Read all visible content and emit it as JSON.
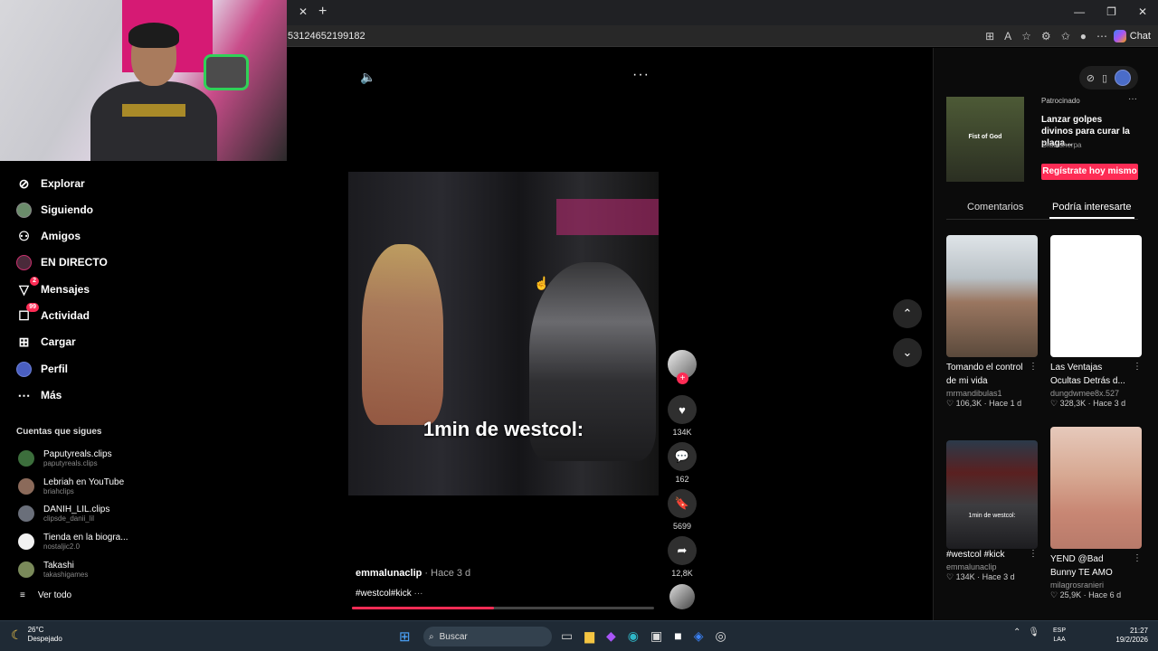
{
  "browser": {
    "tab_close": "✕",
    "new_tab": "+",
    "url": "53124652199182",
    "chat_label": "Chat",
    "window_controls": [
      "—",
      "❐",
      "✕"
    ],
    "toolbar_icons": [
      "grid-icon",
      "translate-icon",
      "star-icon",
      "extensions-icon",
      "favorites-icon",
      "profile-icon",
      "menu-icon"
    ]
  },
  "sidebar": {
    "items": [
      {
        "label": "Explorar",
        "icon": "compass-icon",
        "glyph": "⊘"
      },
      {
        "label": "Siguiendo",
        "icon": "avatar-icon",
        "glyph": ""
      },
      {
        "label": "Amigos",
        "icon": "people-icon",
        "glyph": "⚇"
      },
      {
        "label": "EN DIRECTO",
        "icon": "live-icon",
        "glyph": ""
      },
      {
        "label": "Mensajes",
        "icon": "send-icon",
        "glyph": "▽",
        "badge": "2"
      },
      {
        "label": "Actividad",
        "icon": "activity-icon",
        "glyph": "☐",
        "badge": "99"
      },
      {
        "label": "Cargar",
        "icon": "plus-icon",
        "glyph": "⊞"
      },
      {
        "label": "Perfil",
        "icon": "profile-avatar-icon",
        "glyph": ""
      },
      {
        "label": "Más",
        "icon": "more-icon",
        "glyph": "⋯"
      }
    ],
    "following_title": "Cuentas que sigues",
    "accounts": [
      {
        "name": "Paputyreals.clips",
        "handle": "paputyreals.clips"
      },
      {
        "name": "Lebriah en YouTube",
        "handle": "briahclips"
      },
      {
        "name": "DANIH_LIL.clips",
        "handle": "clipsde_danii_lil"
      },
      {
        "name": "Tienda en la biogra...",
        "handle": "nostaljic2.0"
      },
      {
        "name": "Takashi",
        "handle": "takashigames"
      }
    ],
    "see_all": "Ver todo"
  },
  "video": {
    "caption": "1min de westcol:",
    "author": "emmalunaclip",
    "time": "· Hace 3 d",
    "hashtags": "#westcol#kick",
    "more": "···",
    "progress": 0.47
  },
  "actions": {
    "likes": "134K",
    "comments": "162",
    "saves": "5699",
    "shares": "12,8K"
  },
  "ad": {
    "thumb_text": "Fist of God",
    "label": "Patrocinado",
    "title": "Lanzar golpes divinos para curar la plaga...",
    "sponsor": "Gran sherpa",
    "cta": "Regístrate hoy mismo"
  },
  "right_tabs": {
    "comments": "Comentarios",
    "suggested": "Podría interesarte"
  },
  "cards": [
    {
      "title": "Tomando el control de mi vida",
      "user": "mrmandibulas1",
      "likes": "106,3K",
      "time": "Hace 1 d"
    },
    {
      "title": "Las Ventajas Ocultas Detrás d...",
      "user": "dungdwmee8x.527",
      "likes": "328,3K",
      "time": "Hace 3 d"
    },
    {
      "title": "#westcol #kick",
      "user": "emmalunaclip",
      "likes": "134K",
      "time": "Hace 3 d",
      "thumb_text": "1min de westcol:"
    },
    {
      "title": "YEND @Bad Bunny TE AMO",
      "user": "milagrosranieri",
      "likes": "25,9K",
      "time": "Hace 6 d"
    }
  ],
  "taskbar": {
    "temp": "26°C",
    "weather": "Despejado",
    "search": "Buscar",
    "lang1": "ESP",
    "lang2": "LAA",
    "time": "21:27",
    "date": "19/2/2026"
  }
}
